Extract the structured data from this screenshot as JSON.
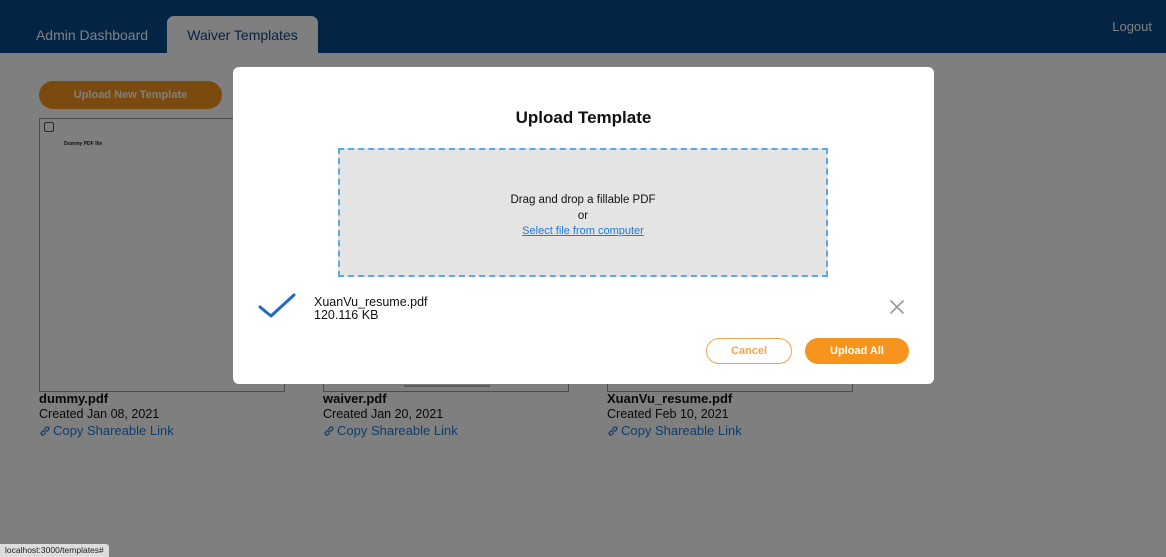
{
  "header": {
    "tabs": [
      {
        "label": "Admin Dashboard"
      },
      {
        "label": "Waiver Templates"
      }
    ],
    "logout_label": "Logout"
  },
  "page": {
    "upload_new_label": "Upload New Template",
    "templates": [
      {
        "name": "dummy.pdf",
        "created": "Created Jan 08, 2021",
        "link_label": "Copy Shareable Link",
        "preview_text": "Dummy PDF file"
      },
      {
        "name": "waiver.pdf",
        "created": "Created Jan 20, 2021",
        "link_label": "Copy Shareable Link"
      },
      {
        "name": "XuanVu_resume.pdf",
        "created": "Created Feb 10, 2021",
        "link_label": "Copy Shareable Link"
      }
    ]
  },
  "status_bar": "localhost:3000/templates#",
  "modal": {
    "title": "Upload Template",
    "dropzone": {
      "main": "Drag and drop a fillable PDF",
      "or": "or",
      "select_label": "Select file from computer"
    },
    "file": {
      "name": "XuanVu_resume.pdf",
      "size": "120.116 KB"
    },
    "cancel_label": "Cancel",
    "upload_all_label": "Upload All"
  },
  "colors": {
    "header_blue": "#08498a",
    "accent_orange": "#f7941d",
    "link_blue": "#1f7ad6",
    "dropzone_border": "#5aa9e6"
  },
  "icons": {
    "check": "check-icon",
    "remove": "close-icon",
    "link": "link-icon"
  }
}
